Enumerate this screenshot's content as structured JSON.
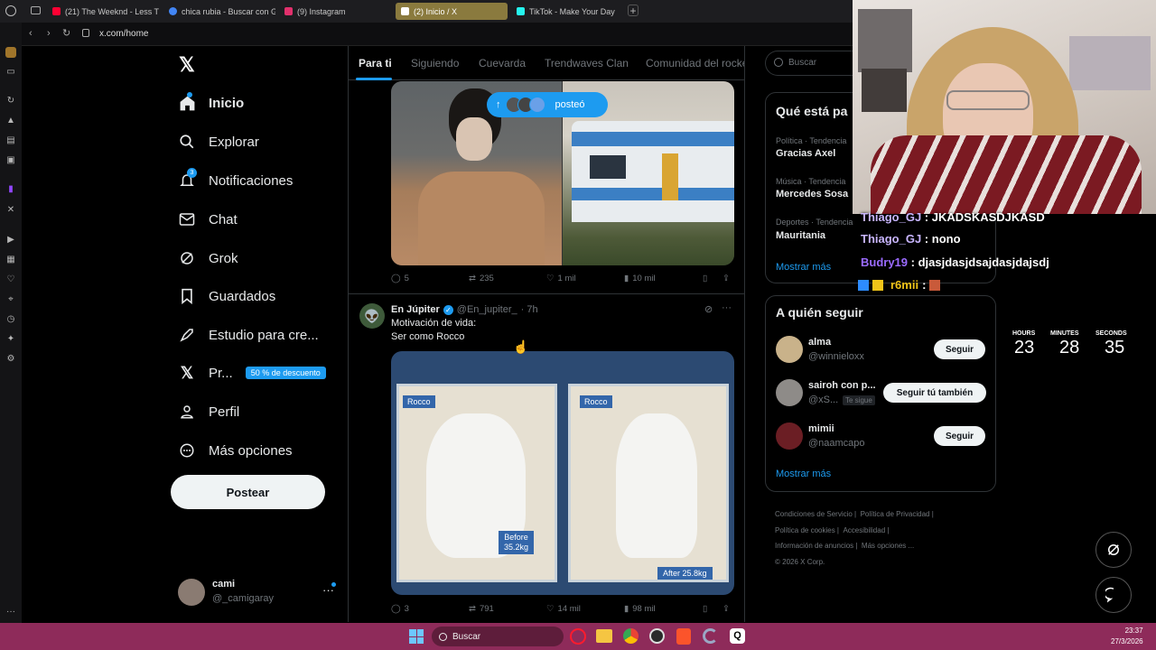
{
  "browser": {
    "tabs": [
      {
        "label": "(21) The Weeknd - Less Th",
        "color": "#ff0033"
      },
      {
        "label": "chica rubia - Buscar con G",
        "color": "#4285f4"
      },
      {
        "label": "(9) Instagram",
        "color": "#e1306c"
      },
      {
        "label": "(2) Inicio / X",
        "color": "#ffffff"
      },
      {
        "label": "TikTok - Make Your Day",
        "color": "#25f4ee"
      }
    ],
    "new_tab": "+",
    "url": "x.com/home"
  },
  "nav": {
    "items": [
      {
        "label": "Inicio",
        "icon": "home-icon"
      },
      {
        "label": "Explorar",
        "icon": "search-icon"
      },
      {
        "label": "Notificaciones",
        "icon": "bell-icon",
        "badge": "3"
      },
      {
        "label": "Chat",
        "icon": "mail-icon"
      },
      {
        "label": "Grok",
        "icon": "grok-icon"
      },
      {
        "label": "Guardados",
        "icon": "bookmark-icon"
      },
      {
        "label": "Estudio para cre...",
        "icon": "rocket-icon"
      },
      {
        "label": "Pr...",
        "icon": "x-icon",
        "promo": "50 % de descuento"
      },
      {
        "label": "Perfil",
        "icon": "user-icon"
      },
      {
        "label": "Más opciones",
        "icon": "more-icon"
      }
    ],
    "post_label": "Postear",
    "account": {
      "name": "cami",
      "handle": "@_camigaray"
    }
  },
  "feed": {
    "tabs": [
      "Para ti",
      "Siguiendo",
      "Cuevarda",
      "Trendwaves Clan",
      "Comunidad del rocke"
    ],
    "posted_pill": "posteó",
    "post1_actions": {
      "replies": "5",
      "reposts": "235",
      "likes": "1 mil",
      "views": "10 mil"
    },
    "post2": {
      "name": "En Júpiter",
      "handle": "@En_jupiter_",
      "time": "· 7h",
      "line1": "Motivación de vida:",
      "line2": "Ser como Rocco",
      "img_labels": {
        "left_name": "Rocco",
        "right_name": "Rocco",
        "before": "Before",
        "before_kg": "35.2kg",
        "after": "After 25.8kg"
      },
      "actions": {
        "replies": "3",
        "reposts": "791",
        "likes": "14 mil",
        "views": "98 mil"
      }
    }
  },
  "right": {
    "search_placeholder": "Buscar",
    "trends_title": "Qué está pa",
    "trends": [
      {
        "meta": "Política · Tendencia",
        "name": "Gracias Axel"
      },
      {
        "meta": "Música · Tendencia",
        "name": "Mercedes Sosa"
      },
      {
        "meta": "Deportes · Tendencia",
        "name": "Mauritania"
      }
    ],
    "show_more": "Mostrar más",
    "who_title": "A quién seguir",
    "who": [
      {
        "name": "alma",
        "handle": "@winnieloxx",
        "button": "Seguir"
      },
      {
        "name": "sairoh con p...",
        "handle": "@xS...",
        "tag": "Te sigue",
        "button": "Seguir tú también"
      },
      {
        "name": "mimii",
        "handle": "@naamcapo",
        "button": "Seguir"
      }
    ],
    "show_more2": "Mostrar más",
    "footer": [
      "Condiciones de Servicio",
      "Política de Privacidad",
      "Política de cookies",
      "Accesibilidad",
      "Información de anuncios",
      "Más opciones ...",
      "© 2026 X Corp."
    ]
  },
  "stream": {
    "chat": [
      {
        "user": "Thiago_GJ",
        "msg": "JKADSKASDJKASD",
        "color": "#c9b6ff"
      },
      {
        "user": "Thiago_GJ",
        "msg": "nono",
        "color": "#c9b6ff"
      },
      {
        "user": "Budry19",
        "msg": "djasjdasjdsajdasjdajsdj",
        "color": "#9b6bff"
      },
      {
        "user": "r6mii",
        "msg": "",
        "color": "#f0c419"
      }
    ],
    "timer": [
      {
        "label": "HOURS",
        "value": "23"
      },
      {
        "label": "MINUTES",
        "value": "28"
      },
      {
        "label": "SECONDS",
        "value": "35"
      }
    ]
  },
  "taskbar": {
    "search": "Buscar",
    "time": "23:37",
    "date": "27/3/2026"
  }
}
